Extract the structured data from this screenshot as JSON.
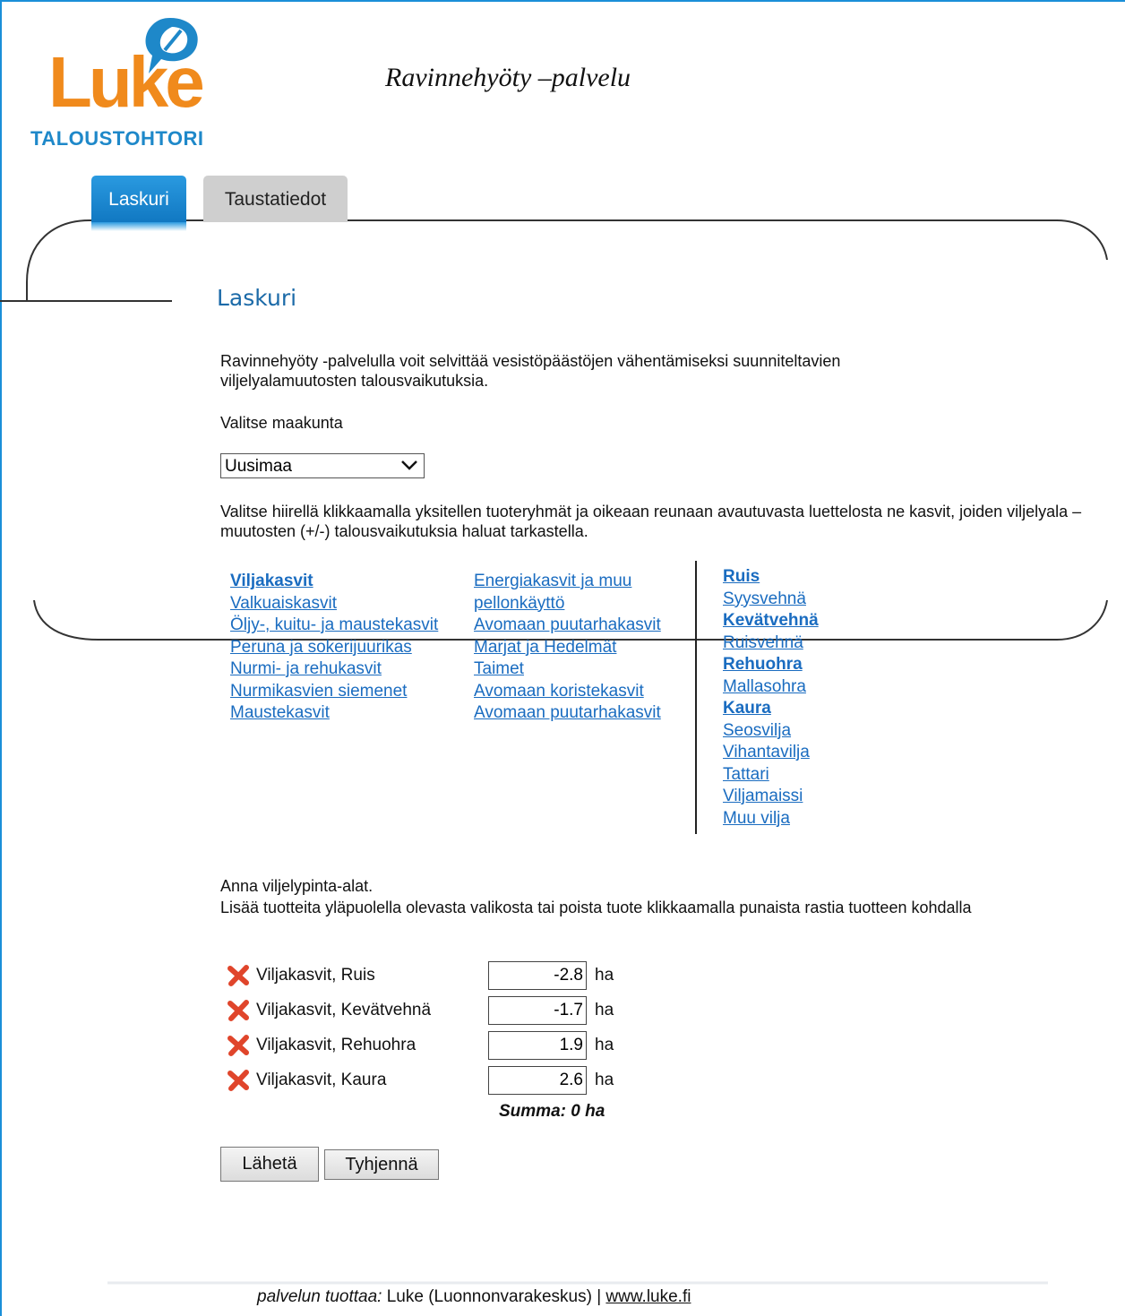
{
  "brand": {
    "logo_word": "Luke",
    "logo_subtitle": "TALOUSTOHTORI",
    "logo_color": "#f08a1c",
    "subtitle_color": "#1e88c9"
  },
  "service_title": "Ravinnehyöty –palvelu",
  "tabs": [
    {
      "label": "Laskuri",
      "active": true
    },
    {
      "label": "Taustatiedot",
      "active": false
    }
  ],
  "page": {
    "heading": "Laskuri",
    "intro": "Ravinnehyöty -palvelulla voit selvittää vesistöpäästöjen vähentämiseksi suunniteltavien viljelyalamuutosten talousvaikutuksia.",
    "region_label": "Valitse maakunta",
    "region_selected": "Uusimaa",
    "instructions": "Valitse hiirellä klikkaamalla yksitellen tuoteryhmät ja oikeaan reunaan avautuvasta luettelosta ne kasvit, joiden viljelyala –muutosten (+/-) talousvaikutuksia haluat tarkastella."
  },
  "groups_col1": [
    {
      "label": "Viljakasvit",
      "selected": true
    },
    {
      "label": "Valkuaiskasvit",
      "selected": false
    },
    {
      "label": "Öljy-, kuitu- ja maustekasvit",
      "selected": false
    },
    {
      "label": "Peruna ja sokerijuurikas",
      "selected": false
    },
    {
      "label": "Nurmi- ja rehukasvit",
      "selected": false
    },
    {
      "label": "Nurmikasvien siemenet",
      "selected": false
    },
    {
      "label": "Maustekasvit",
      "selected": false
    }
  ],
  "groups_col2": [
    {
      "label": "Energiakasvit ja muu",
      "selected": false
    },
    {
      "label": "pellonkäyttö",
      "selected": false
    },
    {
      "label": "Avomaan puutarhakasvit",
      "selected": false
    },
    {
      "label": "Marjat ja Hedelmät",
      "selected": false
    },
    {
      "label": "Taimet",
      "selected": false
    },
    {
      "label": "Avomaan koristekasvit",
      "selected": false
    },
    {
      "label": "Avomaan puutarhakasvit",
      "selected": false
    }
  ],
  "crops": [
    {
      "label": "Ruis",
      "selected": true
    },
    {
      "label": "Syysvehnä",
      "selected": false
    },
    {
      "label": "Kevätvehnä",
      "selected": true
    },
    {
      "label": "Ruisvehnä",
      "selected": false
    },
    {
      "label": "Rehuohra",
      "selected": true
    },
    {
      "label": "Mallasohra",
      "selected": false
    },
    {
      "label": "Kaura",
      "selected": true
    },
    {
      "label": "Seosvilja",
      "selected": false
    },
    {
      "label": "Vihantavilja",
      "selected": false
    },
    {
      "label": "Tattari",
      "selected": false
    },
    {
      "label": "Viljamaissi",
      "selected": false
    },
    {
      "label": "Muu vilja",
      "selected": false
    }
  ],
  "area": {
    "line1": "Anna viljelypinta-alat.",
    "line2": "Lisää tuotteita yläpuolella olevasta valikosta tai poista tuote klikkaamalla punaista rastia tuotteen kohdalla",
    "unit": "ha",
    "rows": [
      {
        "label": "Viljakasvit, Ruis",
        "value": "-2.8"
      },
      {
        "label": "Viljakasvit, Kevätvehnä",
        "value": "-1.7"
      },
      {
        "label": "Viljakasvit, Rehuohra",
        "value": "1.9"
      },
      {
        "label": "Viljakasvit, Kaura",
        "value": "2.6"
      }
    ],
    "sum": "Summa: 0 ha"
  },
  "buttons": {
    "send": "Lähetä",
    "clear": "Tyhjennä"
  },
  "footer": {
    "producer_label": "palvelun tuottaa:",
    "producer": " Luke (Luonnonvarakeskus) | ",
    "link": "www.luke.fi"
  },
  "colors": {
    "accent": "#1a8fd8",
    "link": "#1a6cc0",
    "remove": "#e0452b"
  }
}
